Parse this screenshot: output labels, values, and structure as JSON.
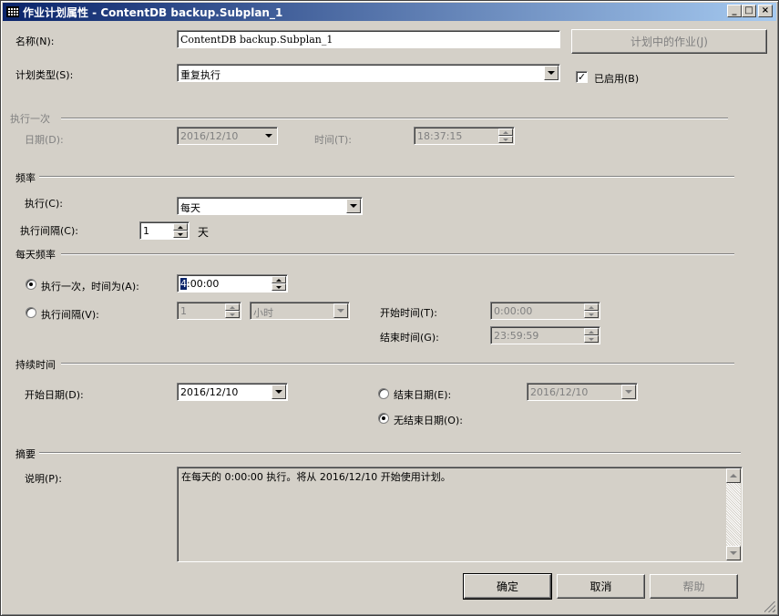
{
  "window": {
    "title": "作业计划属性 - ContentDB backup.Subplan_1",
    "minimize_icon": "minimize-icon",
    "maximize_icon": "maximize-icon",
    "close_icon": "close-icon"
  },
  "top": {
    "name_label": "名称(N):",
    "name_value": "ContentDB backup.Subplan_1",
    "jobs_button": "计划中的作业(J)",
    "schedule_type_label": "计划类型(S):",
    "schedule_type_value": "重复执行",
    "enabled_label": "已启用(B)",
    "enabled_checked": true
  },
  "one_time": {
    "header": "执行一次",
    "date_label": "日期(D):",
    "date_value": "2016/12/10",
    "time_label": "时间(T):",
    "time_value": "18:37:15"
  },
  "frequency": {
    "header": "频率",
    "occurs_label": "执行(C):",
    "occurs_value": "每天",
    "recurs_label": "执行间隔(C):",
    "recurs_value": "1",
    "recurs_unit": "天"
  },
  "daily_frequency": {
    "header": "每天频率",
    "once_label": "执行一次，时间为(A):",
    "once_selected": true,
    "once_time_sel": "4",
    "once_time_rest": ":00:00",
    "every_label": "执行间隔(V):",
    "every_value": "1",
    "every_unit": "小时",
    "start_label": "开始时间(T):",
    "start_value": "0:00:00",
    "end_label": "结束时间(G):",
    "end_value": "23:59:59"
  },
  "duration": {
    "header": "持续时间",
    "start_date_label": "开始日期(D):",
    "start_date_value": "2016/12/10",
    "end_date_label": "结束日期(E):",
    "end_date_value": "2016/12/10",
    "no_end_label": "无结束日期(O):",
    "no_end_selected": true
  },
  "summary": {
    "header": "摘要",
    "description_label": "说明(P):",
    "description_text": "在每天的 0:00:00 执行。将从 2016/12/10 开始使用计划。"
  },
  "footer": {
    "ok": "确定",
    "cancel": "取消",
    "help": "帮助"
  }
}
